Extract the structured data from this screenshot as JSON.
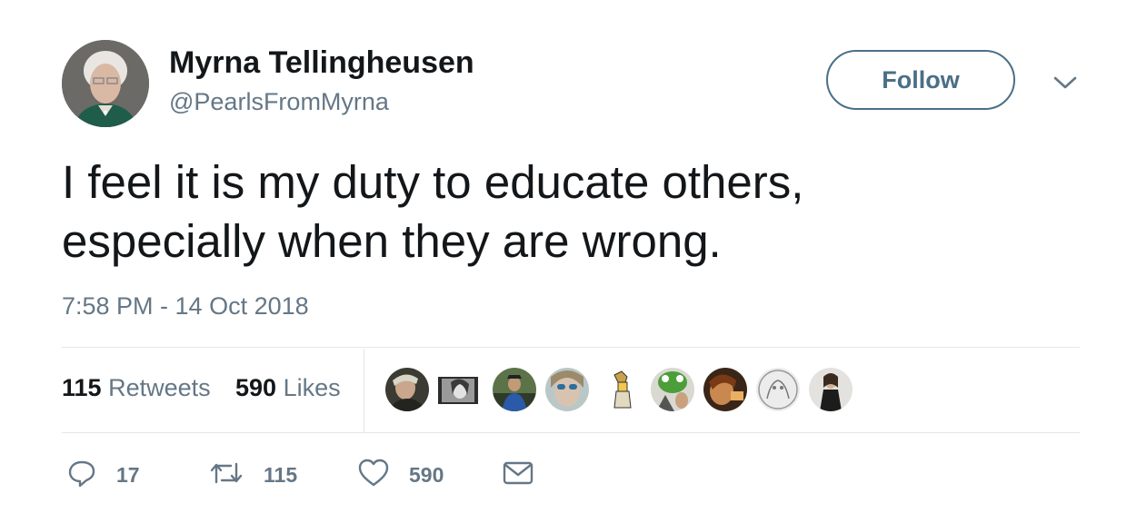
{
  "author": {
    "name": "Myrna Tellingheusen",
    "handle": "@PearlsFromMyrna"
  },
  "follow_button": {
    "label": "Follow"
  },
  "tweet": {
    "lines": [
      "I feel it is my duty to educate others,",
      "especially when they are wrong."
    ],
    "timestamp": "7:58 PM - 14 Oct 2018"
  },
  "stats": {
    "retweets_count": "115",
    "retweets_label": "Retweets",
    "likes_count": "590",
    "likes_label": "Likes"
  },
  "likers": [
    {
      "icon": "avatar-photo"
    },
    {
      "icon": "avatar-photo"
    },
    {
      "icon": "avatar-photo"
    },
    {
      "icon": "avatar-photo"
    },
    {
      "icon": "avatar-cartoon"
    },
    {
      "icon": "avatar-photo"
    },
    {
      "icon": "avatar-photo"
    },
    {
      "icon": "avatar-drawing"
    },
    {
      "icon": "avatar-photo"
    }
  ],
  "actions": {
    "reply_count": "17",
    "retweet_count": "115",
    "like_count": "590"
  },
  "colors": {
    "text": "#14171a",
    "secondary": "#657786",
    "follow_border": "#4a6f86",
    "divider": "#e1e8ed"
  }
}
